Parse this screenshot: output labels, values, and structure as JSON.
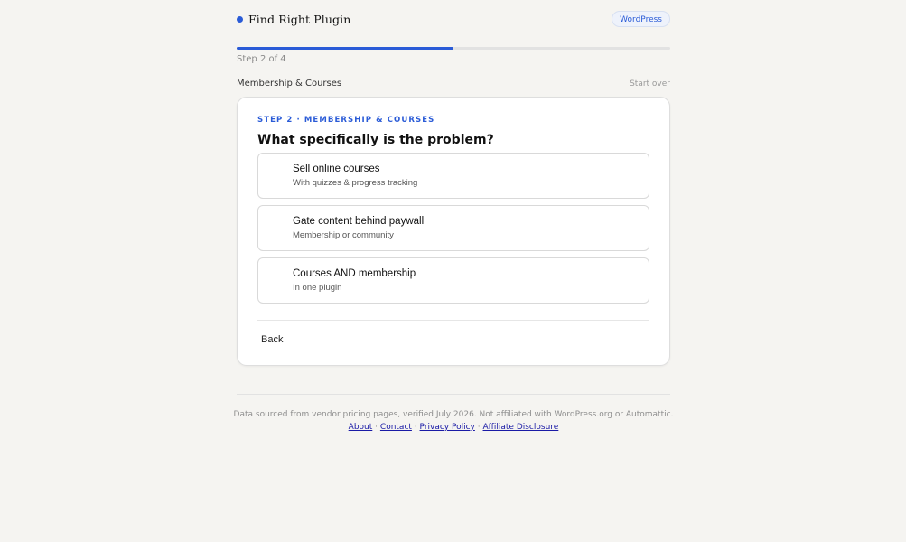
{
  "header": {
    "brand": "Find Right Plugin",
    "badge": "WordPress"
  },
  "progress": {
    "fraction": 0.5,
    "label": "Step 2 of 4"
  },
  "section": {
    "label": "Membership & Courses",
    "start_over": "Start over"
  },
  "card": {
    "eyebrow": "STEP 2 · MEMBERSHIP & COURSES",
    "question": "What specifically is the problem?",
    "options": [
      {
        "title": "Sell online courses",
        "subtitle": "With quizzes & progress tracking"
      },
      {
        "title": "Gate content behind paywall",
        "subtitle": "Membership or community"
      },
      {
        "title": "Courses AND membership",
        "subtitle": "In one plugin"
      }
    ],
    "back_label": "Back"
  },
  "footer": {
    "note": "Data sourced from vendor pricing pages, verified July 2026. Not affiliated with WordPress.org or Automattic.",
    "links": [
      "About",
      "Contact",
      "Privacy Policy",
      "Affiliate Disclosure"
    ],
    "separator": "·"
  },
  "colors": {
    "accent": "#2a5bd7",
    "background": "#f5f4f1",
    "link": "#1a1aa6"
  }
}
